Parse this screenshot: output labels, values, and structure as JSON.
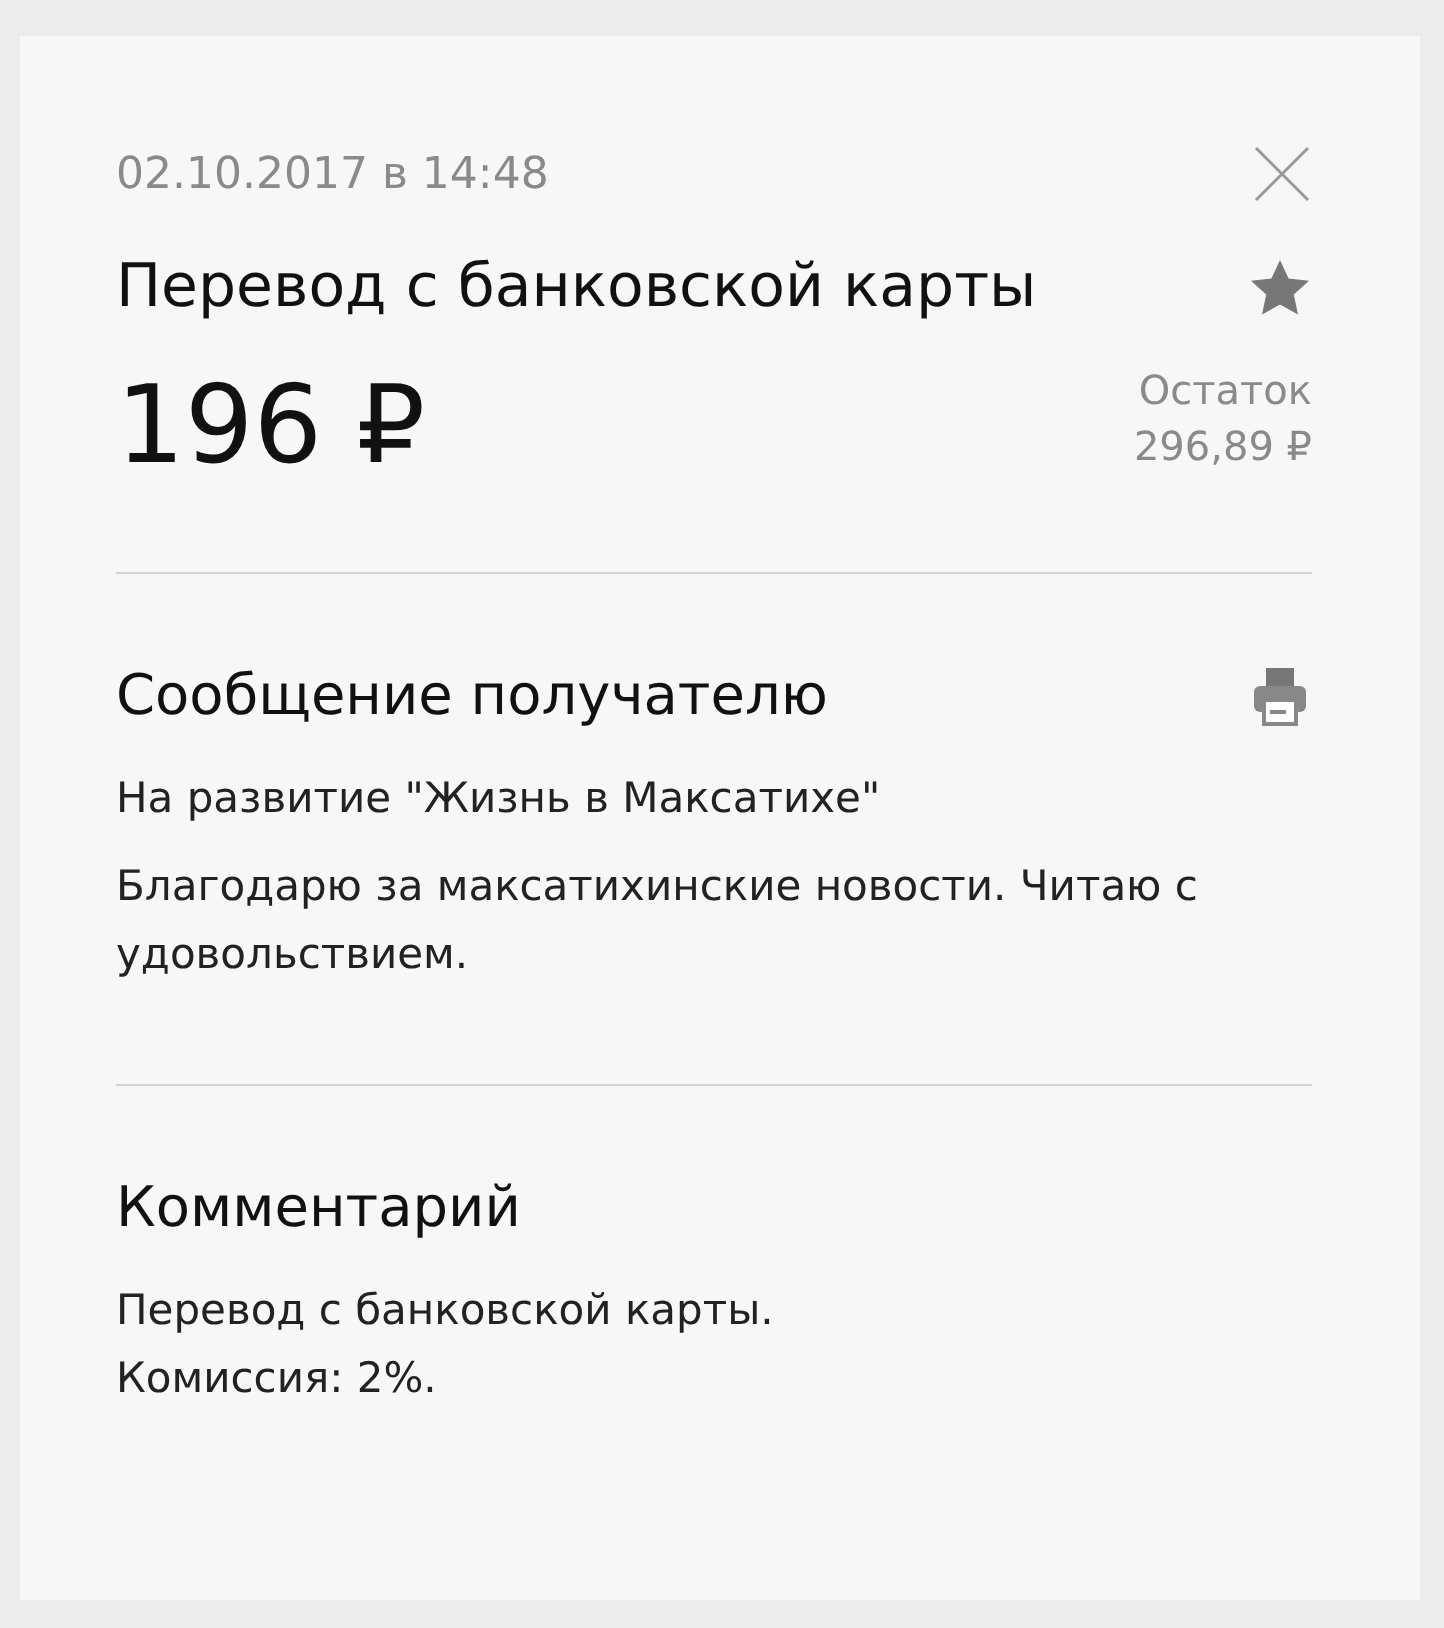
{
  "date": "02.10.2017 в 14:48",
  "title": "Перевод с банковской карты",
  "amount": "196 ₽",
  "balance": {
    "label": "Остаток",
    "value": "296,89 ₽"
  },
  "sections": [
    {
      "kind": "message",
      "heading": "Сообщение получателю",
      "paragraphs": [
        "На развитие \"Жизнь в Максатихе\"",
        "Благодарю за максатихинские новости. Читаю с удовольствием."
      ]
    },
    {
      "kind": "comment",
      "heading": "Комментарий",
      "paragraphs": [
        "Перевод с банковской карты.\nКомиссия: 2%."
      ]
    }
  ]
}
